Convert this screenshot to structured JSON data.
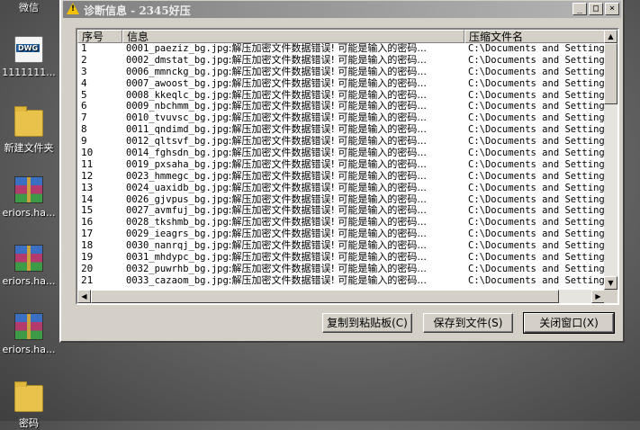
{
  "desktop": {
    "icons": [
      {
        "label": "微信",
        "type": "wechat"
      },
      {
        "label": "1111111...",
        "type": "dwg",
        "badge": "DWG"
      },
      {
        "label": "新建文件夹",
        "type": "folder"
      },
      {
        "label": "eriors.ha...",
        "type": "rar"
      },
      {
        "label": "eriors.ha...",
        "type": "rar"
      },
      {
        "label": "eriors.ha...",
        "type": "rar"
      },
      {
        "label": "密码",
        "type": "folder"
      }
    ]
  },
  "window": {
    "title": "诊断信息 - 2345好压",
    "title_icon": "warning-icon",
    "controls": {
      "minimize": "_",
      "maximize": "□",
      "close": "×"
    }
  },
  "list": {
    "columns": [
      "序号",
      "信息",
      "压缩文件名"
    ],
    "rows": [
      {
        "num": "1",
        "file": "0001_paeziz_bg.jpg",
        "msg": "解压加密文件数据错误! 可能是输入的密码...",
        "archive": "C:\\Documents and Settings"
      },
      {
        "num": "2",
        "file": "0002_dmstat_bg.jpg",
        "msg": "解压加密文件数据错误! 可能是输入的密码...",
        "archive": "C:\\Documents and Settings"
      },
      {
        "num": "3",
        "file": "0006_mmnckg_bg.jpg",
        "msg": "解压加密文件数据错误! 可能是输入的密码...",
        "archive": "C:\\Documents and Settings"
      },
      {
        "num": "4",
        "file": "0007_awoost_bg.jpg",
        "msg": "解压加密文件数据错误! 可能是输入的密码...",
        "archive": "C:\\Documents and Settings"
      },
      {
        "num": "5",
        "file": "0008_kkeqlc_bg.jpg",
        "msg": "解压加密文件数据错误! 可能是输入的密码...",
        "archive": "C:\\Documents and Settings"
      },
      {
        "num": "6",
        "file": "0009_nbchmm_bg.jpg",
        "msg": "解压加密文件数据错误! 可能是输入的密码...",
        "archive": "C:\\Documents and Settings"
      },
      {
        "num": "7",
        "file": "0010_tvuvsc_bg.jpg",
        "msg": "解压加密文件数据错误! 可能是输入的密码...",
        "archive": "C:\\Documents and Settings"
      },
      {
        "num": "8",
        "file": "0011_qndimd_bg.jpg",
        "msg": "解压加密文件数据错误! 可能是输入的密码...",
        "archive": "C:\\Documents and Settings"
      },
      {
        "num": "9",
        "file": "0012_qltsvf_bg.jpg",
        "msg": "解压加密文件数据错误! 可能是输入的密码...",
        "archive": "C:\\Documents and Settings"
      },
      {
        "num": "10",
        "file": "0014_fghsdn_bg.jpg",
        "msg": "解压加密文件数据错误! 可能是输入的密码...",
        "archive": "C:\\Documents and Settings"
      },
      {
        "num": "11",
        "file": "0019_pxsaha_bg.jpg",
        "msg": "解压加密文件数据错误! 可能是输入的密码...",
        "archive": "C:\\Documents and Settings"
      },
      {
        "num": "12",
        "file": "0023_hmmegc_bg.jpg",
        "msg": "解压加密文件数据错误! 可能是输入的密码...",
        "archive": "C:\\Documents and Settings"
      },
      {
        "num": "13",
        "file": "0024_uaxidb_bg.jpg",
        "msg": "解压加密文件数据错误! 可能是输入的密码...",
        "archive": "C:\\Documents and Settings"
      },
      {
        "num": "14",
        "file": "0026_gjvpus_bg.jpg",
        "msg": "解压加密文件数据错误! 可能是输入的密码...",
        "archive": "C:\\Documents and Settings"
      },
      {
        "num": "15",
        "file": "0027_avmfuj_bg.jpg",
        "msg": "解压加密文件数据错误! 可能是输入的密码...",
        "archive": "C:\\Documents and Settings"
      },
      {
        "num": "16",
        "file": "0028_tkshmb_bg.jpg",
        "msg": "解压加密文件数据错误! 可能是输入的密码...",
        "archive": "C:\\Documents and Settings"
      },
      {
        "num": "17",
        "file": "0029_ieagrs_bg.jpg",
        "msg": "解压加密文件数据错误! 可能是输入的密码...",
        "archive": "C:\\Documents and Settings"
      },
      {
        "num": "18",
        "file": "0030_nanrqj_bg.jpg",
        "msg": "解压加密文件数据错误! 可能是输入的密码...",
        "archive": "C:\\Documents and Settings"
      },
      {
        "num": "19",
        "file": "0031_mhdypc_bg.jpg",
        "msg": "解压加密文件数据错误! 可能是输入的密码...",
        "archive": "C:\\Documents and Settings"
      },
      {
        "num": "20",
        "file": "0032_puwrhb_bg.jpg",
        "msg": "解压加密文件数据错误! 可能是输入的密码...",
        "archive": "C:\\Documents and Settings"
      },
      {
        "num": "21",
        "file": "0033_cazaom_bg.jpg",
        "msg": "解压加密文件数据错误! 可能是输入的密码...",
        "archive": "C:\\Documents and Settings"
      }
    ]
  },
  "buttons": {
    "copy": "复制到粘贴板(C)",
    "save": "保存到文件(S)",
    "close": "关闭窗口(X)"
  }
}
